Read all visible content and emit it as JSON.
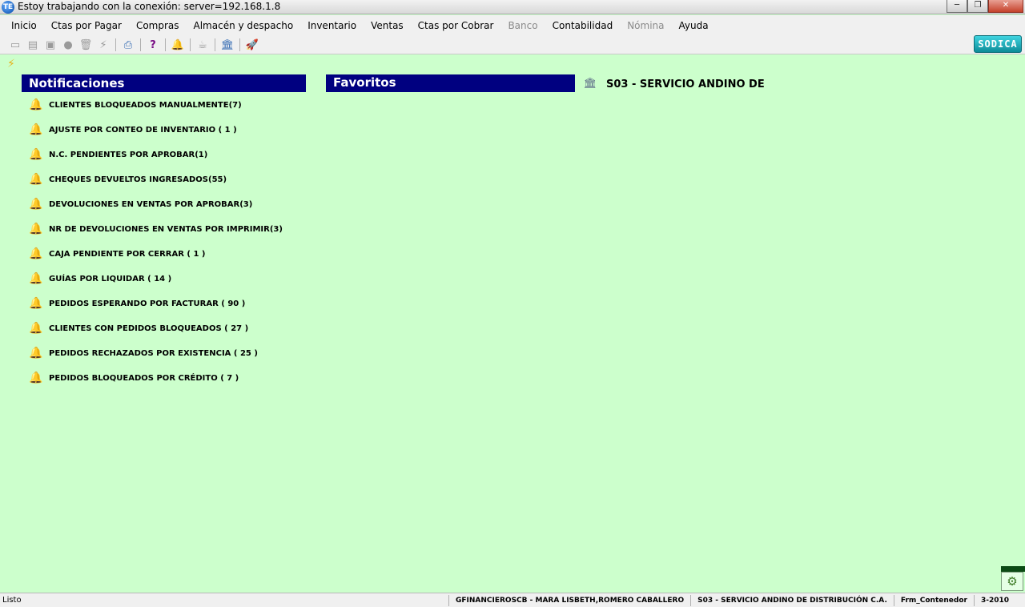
{
  "window": {
    "title": "Estoy trabajando con la conexión: server=192.168.1.8",
    "app_icon": "TE"
  },
  "menu": [
    {
      "label": "Inicio",
      "enabled": true
    },
    {
      "label": "Ctas por Pagar",
      "enabled": true
    },
    {
      "label": "Compras",
      "enabled": true
    },
    {
      "label": "Almacén y despacho",
      "enabled": true
    },
    {
      "label": "Inventario",
      "enabled": true
    },
    {
      "label": "Ventas",
      "enabled": true
    },
    {
      "label": "Ctas por Cobrar",
      "enabled": true
    },
    {
      "label": "Banco",
      "enabled": false
    },
    {
      "label": "Contabilidad",
      "enabled": true
    },
    {
      "label": "Nómina",
      "enabled": false
    },
    {
      "label": "Ayuda",
      "enabled": true
    }
  ],
  "toolbar": {
    "brand": "SODICA",
    "icons": [
      "new-document-icon",
      "open-document-icon",
      "save-icon",
      "record-icon",
      "delete-icon",
      "lightning-icon",
      "print-icon",
      "help-icon",
      "bell-icon",
      "coffee-icon",
      "bank-icon",
      "rocket-icon"
    ]
  },
  "notifications": {
    "title": "Notificaciones",
    "items": [
      "CLIENTES BLOQUEADOS MANUALMENTE(7)",
      "AJUSTE POR CONTEO DE INVENTARIO ( 1 )",
      "N.C. PENDIENTES POR APROBAR(1)",
      "CHEQUES DEVUELTOS INGRESADOS(55)",
      "DEVOLUCIONES EN VENTAS POR APROBAR(3)",
      "NR DE DEVOLUCIONES EN VENTAS POR IMPRIMIR(3)",
      "CAJA PENDIENTE POR CERRAR  ( 1 )",
      "GUÍAS POR LIQUIDAR  ( 14 )",
      "PEDIDOS ESPERANDO POR FACTURAR  ( 90 )",
      "CLIENTES CON PEDIDOS BLOQUEADOS  ( 27 )",
      "PEDIDOS RECHAZADOS POR EXISTENCIA  ( 25 )",
      "PEDIDOS BLOQUEADOS POR CRÉDITO  ( 7 )"
    ]
  },
  "favorites": {
    "title": "Favoritos"
  },
  "company": {
    "name": "S03 - SERVICIO ANDINO DE"
  },
  "statusbar": {
    "left": "Listo",
    "user": "GFINANCIEROSCB - MARA LISBETH,ROMERO CABALLERO",
    "company": "S03 - SERVICIO ANDINO DE DISTRIBUCIÓN C.A.",
    "form": "Frm_Contenedor",
    "period": "3-2010"
  },
  "colors": {
    "background": "#ccffcc",
    "header": "#000080"
  }
}
